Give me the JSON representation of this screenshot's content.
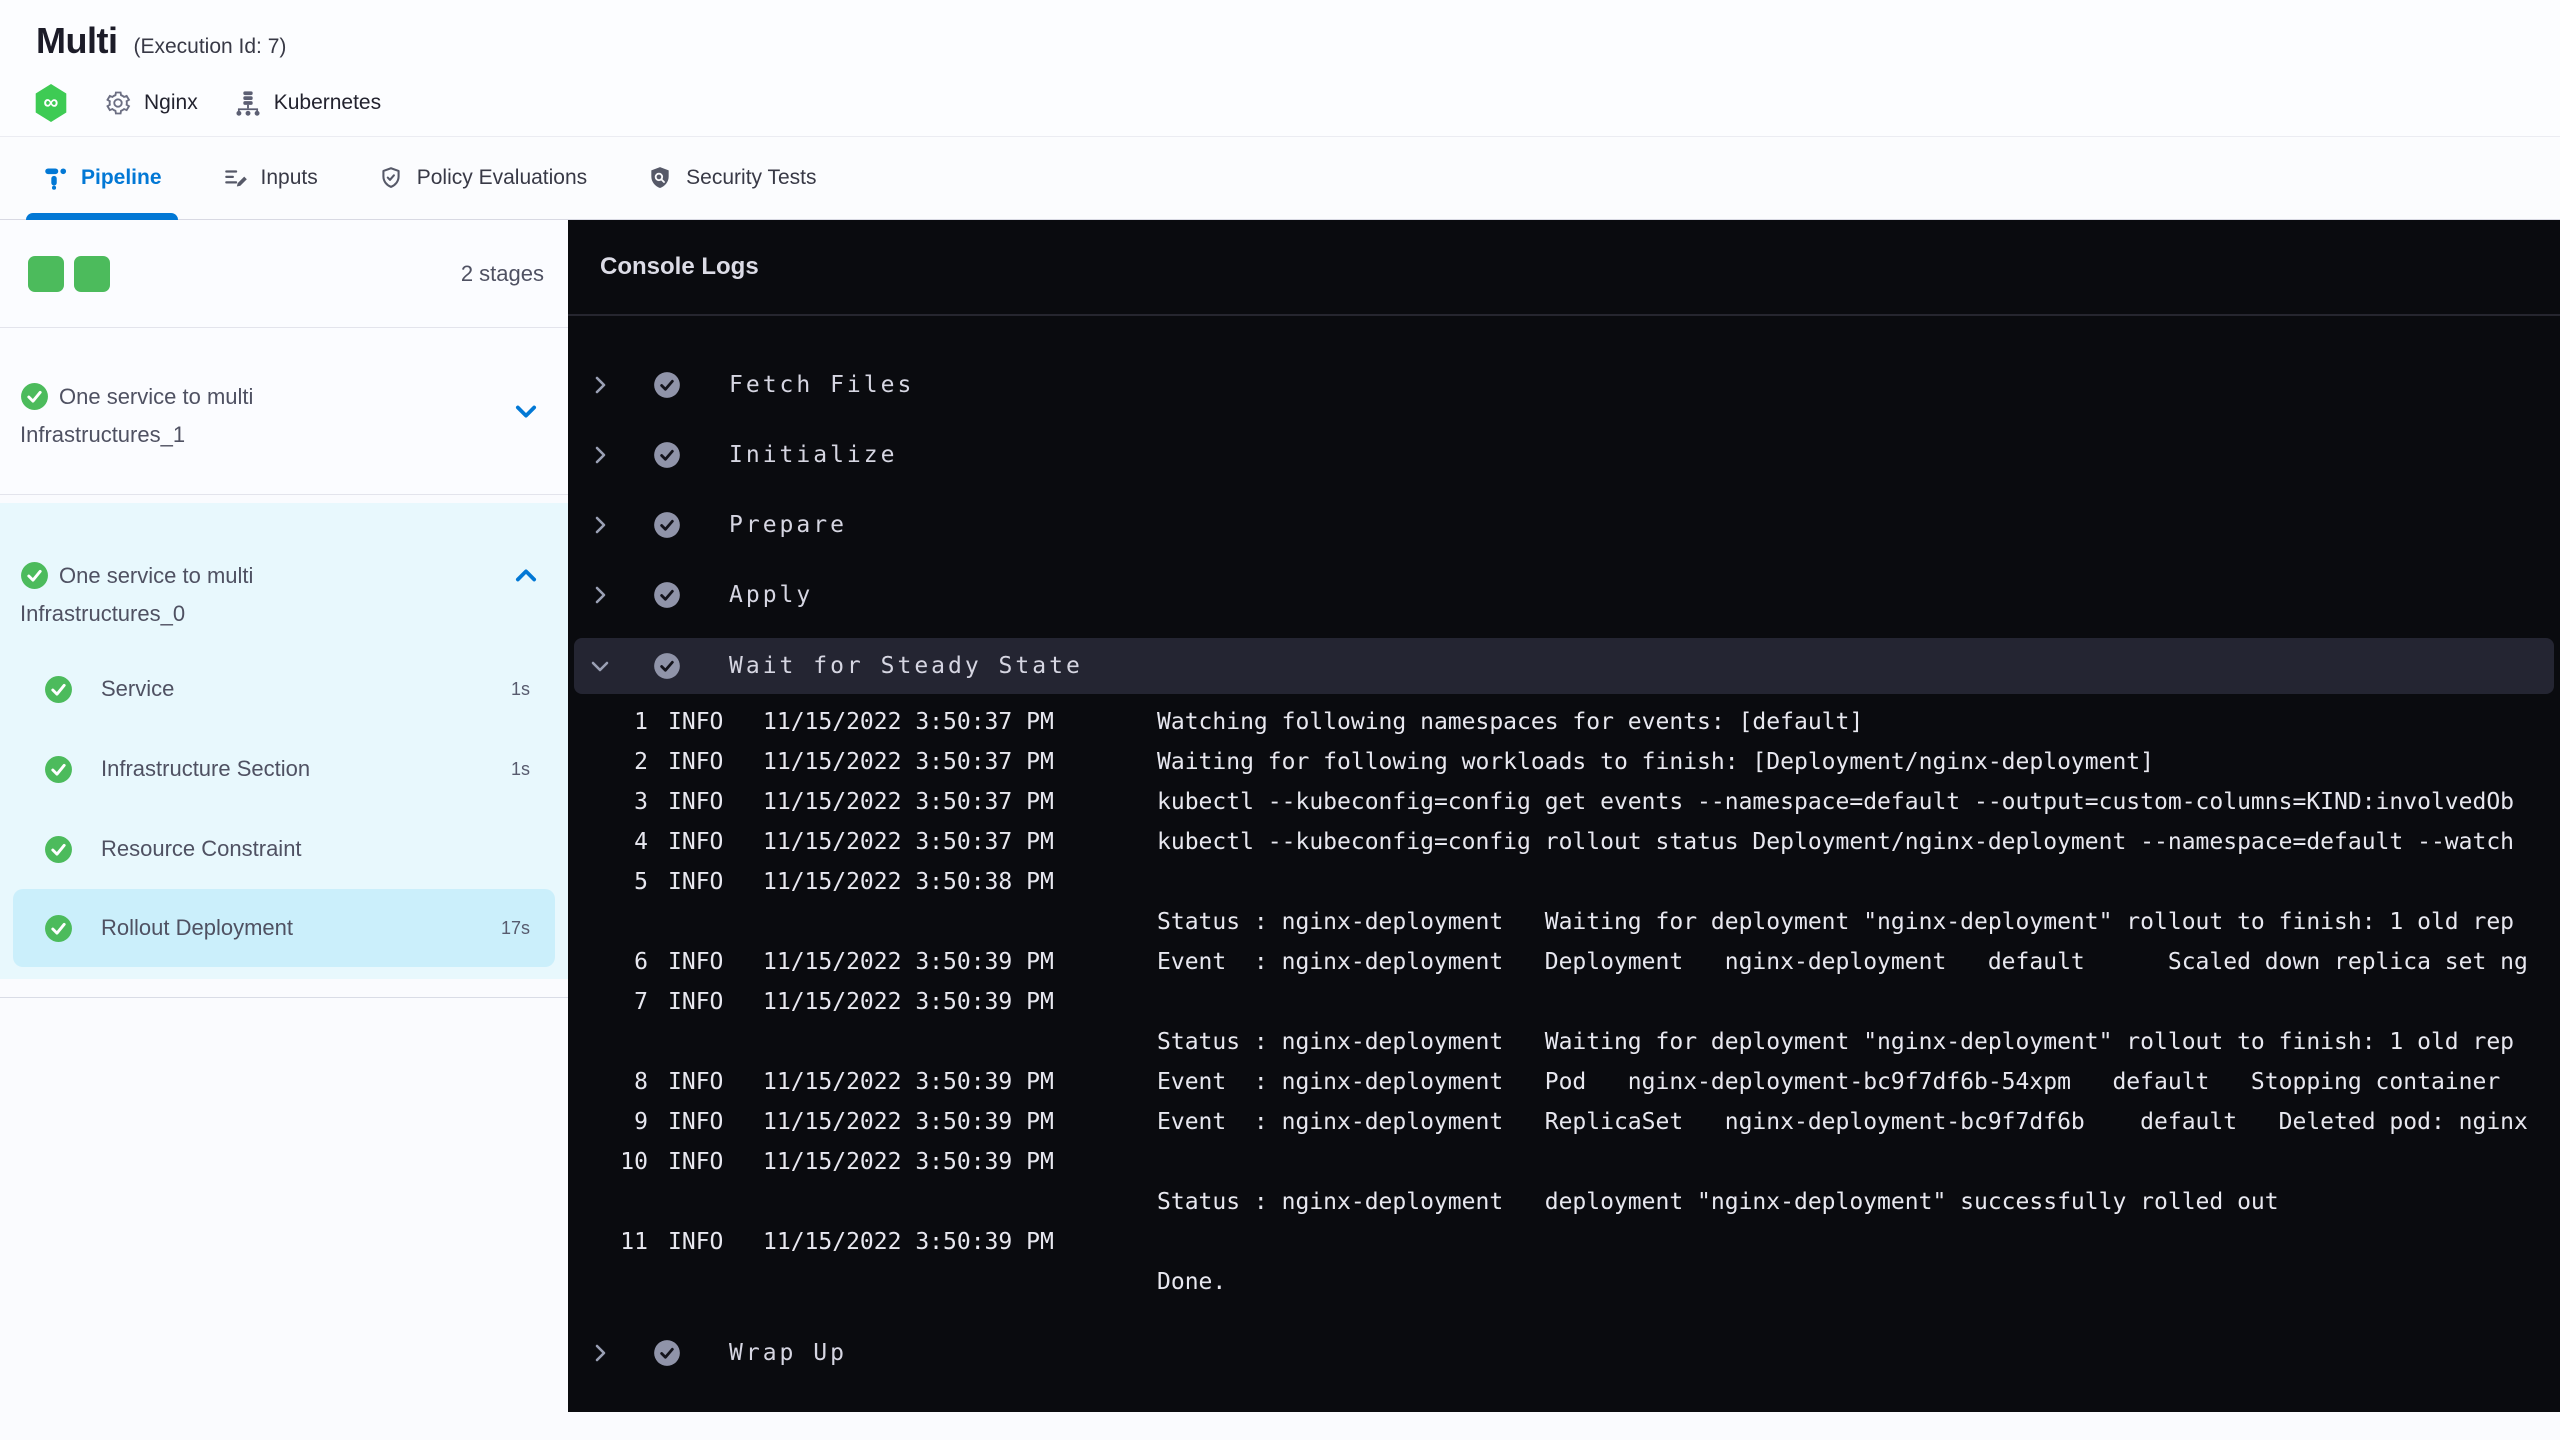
{
  "header": {
    "title": "Multi",
    "execution_id": "(Execution Id: 7)",
    "service_label": "Nginx",
    "infra_label": "Kubernetes",
    "icons": {
      "module": "harness-cd-icon",
      "service": "gear-icon",
      "infra": "kubernetes-icon"
    }
  },
  "tabs": [
    {
      "label": "Pipeline",
      "icon": "pipeline-icon",
      "active": true
    },
    {
      "label": "Inputs",
      "icon": "inputs-icon",
      "active": false
    },
    {
      "label": "Policy Evaluations",
      "icon": "policy-shield-check-icon",
      "active": false
    },
    {
      "label": "Security Tests",
      "icon": "security-shield-search-icon",
      "active": false
    }
  ],
  "sidebar": {
    "stages_count": "2 stages",
    "stages": [
      {
        "name": "One service to multi Infrastructures_1",
        "status": "success",
        "expanded": false
      },
      {
        "name": "One service to multi Infrastructures_0",
        "status": "success",
        "expanded": true,
        "steps": [
          {
            "name": "Service",
            "duration": "1s",
            "status": "success",
            "selected": false
          },
          {
            "name": "Infrastructure Section",
            "duration": "1s",
            "status": "success",
            "selected": false
          },
          {
            "name": "Resource Constraint",
            "duration": "",
            "status": "success",
            "selected": false
          },
          {
            "name": "Rollout Deployment",
            "duration": "17s",
            "status": "success",
            "selected": true
          }
        ]
      }
    ]
  },
  "console": {
    "title": "Console Logs",
    "steps_before": [
      "Fetch Files",
      "Initialize",
      "Prepare",
      "Apply"
    ],
    "expanded_step": "Wait for Steady State",
    "steps_after": [
      "Wrap Up"
    ],
    "logs": [
      {
        "n": "1",
        "level": "INFO",
        "time": "11/15/2022 3:50:37 PM",
        "msg": "Watching following namespaces for events: [default]"
      },
      {
        "n": "2",
        "level": "INFO",
        "time": "11/15/2022 3:50:37 PM",
        "msg": "Waiting for following workloads to finish: [Deployment/nginx-deployment]"
      },
      {
        "n": "3",
        "level": "INFO",
        "time": "11/15/2022 3:50:37 PM",
        "msg": "kubectl --kubeconfig=config get events --namespace=default --output=custom-columns=KIND:involvedOb"
      },
      {
        "n": "4",
        "level": "INFO",
        "time": "11/15/2022 3:50:37 PM",
        "msg": "kubectl --kubeconfig=config rollout status Deployment/nginx-deployment --namespace=default --watch"
      },
      {
        "n": "5",
        "level": "INFO",
        "time": "11/15/2022 3:50:38 PM",
        "msg": ""
      },
      {
        "n": "",
        "level": "",
        "time": "",
        "msg": "Status : nginx-deployment   Waiting for deployment \"nginx-deployment\" rollout to finish: 1 old rep"
      },
      {
        "n": "6",
        "level": "INFO",
        "time": "11/15/2022 3:50:39 PM",
        "msg": "Event  : nginx-deployment   Deployment   nginx-deployment   default      Scaled down replica set ng"
      },
      {
        "n": "7",
        "level": "INFO",
        "time": "11/15/2022 3:50:39 PM",
        "msg": ""
      },
      {
        "n": "",
        "level": "",
        "time": "",
        "msg": "Status : nginx-deployment   Waiting for deployment \"nginx-deployment\" rollout to finish: 1 old rep"
      },
      {
        "n": "8",
        "level": "INFO",
        "time": "11/15/2022 3:50:39 PM",
        "msg": "Event  : nginx-deployment   Pod   nginx-deployment-bc9f7df6b-54xpm   default   Stopping container "
      },
      {
        "n": "9",
        "level": "INFO",
        "time": "11/15/2022 3:50:39 PM",
        "msg": "Event  : nginx-deployment   ReplicaSet   nginx-deployment-bc9f7df6b    default   Deleted pod: nginx"
      },
      {
        "n": "10",
        "level": "INFO",
        "time": "11/15/2022 3:50:39 PM",
        "msg": ""
      },
      {
        "n": "",
        "level": "",
        "time": "",
        "msg": "Status : nginx-deployment   deployment \"nginx-deployment\" successfully rolled out"
      },
      {
        "n": "11",
        "level": "INFO",
        "time": "11/15/2022 3:50:39 PM",
        "msg": ""
      },
      {
        "n": "",
        "level": "",
        "time": "",
        "msg": "Done."
      }
    ]
  },
  "colors": {
    "accent_blue": "#0278d5",
    "success_green": "#4cbb5c",
    "console_bg": "#0a0b0f",
    "console_row_highlight": "#242532",
    "stage_block_bg": "#e8f8fd",
    "selected_step_bg": "#cbeffb"
  }
}
